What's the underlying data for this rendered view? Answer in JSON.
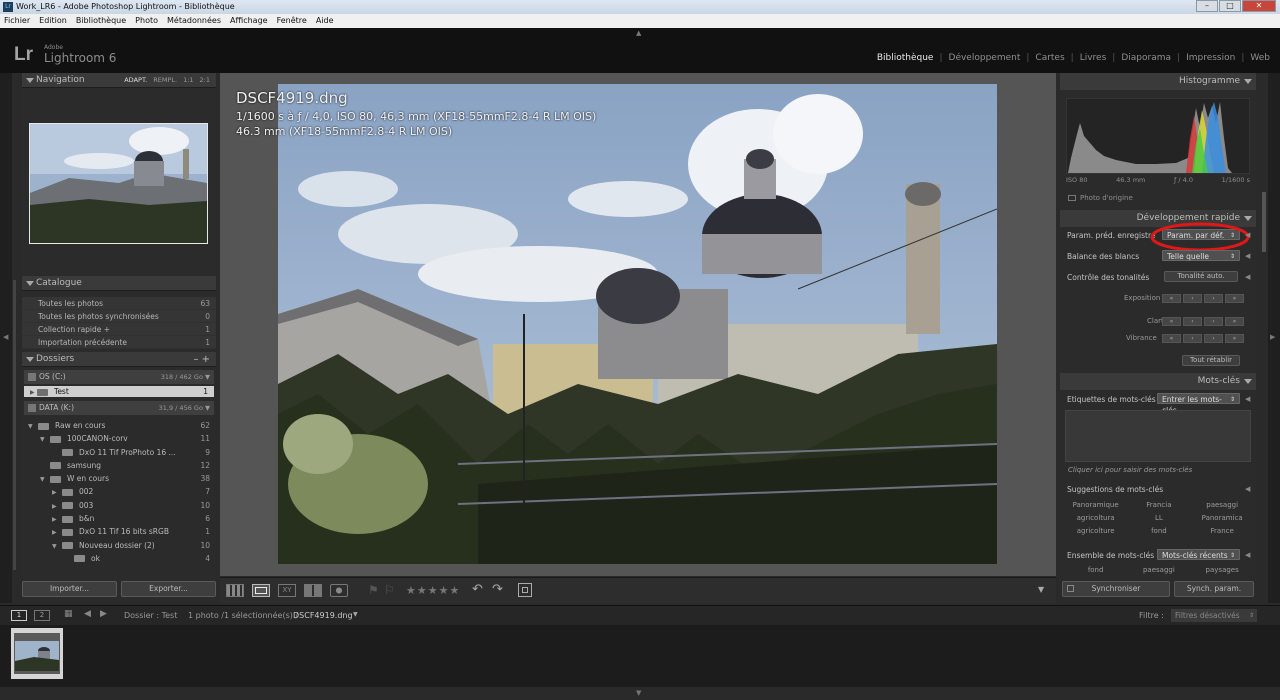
{
  "window": {
    "title": "Work_LR6 - Adobe Photoshop Lightroom - Bibliothèque",
    "app_icon": "Lr",
    "buttons": [
      "–",
      "□",
      "✕"
    ]
  },
  "menu": [
    "Fichier",
    "Edition",
    "Bibliothèque",
    "Photo",
    "Métadonnées",
    "Affichage",
    "Fenêtre",
    "Aide"
  ],
  "brand": {
    "logo": "Lr",
    "adobe": "Adobe",
    "name": "Lightroom 6"
  },
  "modules": [
    {
      "label": "Bibliothèque",
      "active": true
    },
    {
      "label": "Développement"
    },
    {
      "label": "Cartes"
    },
    {
      "label": "Livres"
    },
    {
      "label": "Diaporama"
    },
    {
      "label": "Impression"
    },
    {
      "label": "Web"
    }
  ],
  "left": {
    "navigation": {
      "title": "Navigation",
      "zoom": [
        "ADAPT.",
        "REMPL.",
        "1:1",
        "2:1"
      ]
    },
    "catalog": {
      "title": "Catalogue",
      "items": [
        {
          "label": "Toutes les photos",
          "count": "63"
        },
        {
          "label": "Toutes les photos synchronisées",
          "count": "0"
        },
        {
          "label": "Collection rapide +",
          "count": "1"
        },
        {
          "label": "Importation précédente",
          "count": "1"
        }
      ]
    },
    "folders": {
      "title": "Dossiers",
      "controls": "–  +",
      "volumes": [
        {
          "name": "OS (C:)",
          "size": "318 / 462 Go"
        },
        {
          "name": "DATA (K:)",
          "size": "31,9 / 456 Go"
        }
      ],
      "test_folder": {
        "label": "Test",
        "count": "1"
      },
      "tree": [
        {
          "label": "Raw en cours",
          "count": "62",
          "level": 0,
          "open": true
        },
        {
          "label": "100CANON-corv",
          "count": "11",
          "level": 1,
          "open": true
        },
        {
          "label": "DxO 11 Tif ProPhoto 16 ...",
          "count": "9",
          "level": 2
        },
        {
          "label": "samsung",
          "count": "12",
          "level": 1
        },
        {
          "label": "W en cours",
          "count": "38",
          "level": 1,
          "open": true
        },
        {
          "label": "002",
          "count": "7",
          "level": 2,
          "closed": true
        },
        {
          "label": "003",
          "count": "10",
          "level": 2,
          "closed": true
        },
        {
          "label": "b&n",
          "count": "6",
          "level": 2,
          "closed": true
        },
        {
          "label": "DxO 11 Tif 16 bits sRGB",
          "count": "1",
          "level": 2,
          "closed": true
        },
        {
          "label": "Nouveau dossier (2)",
          "count": "10",
          "level": 2,
          "open": true
        },
        {
          "label": "ok",
          "count": "4",
          "level": 3
        }
      ]
    },
    "import_label": "Importer...",
    "export_label": "Exporter..."
  },
  "photo": {
    "filename": "DSCF4919.dng",
    "info1": "1/1600 s à ƒ / 4,0, ISO 80, 46,3 mm (XF18-55mmF2.8-4 R LM OIS)",
    "info2": "46.3 mm (XF18-55mmF2.8-4 R LM OIS)"
  },
  "toolbar": {
    "stars": "★★★★★"
  },
  "right": {
    "histogram": {
      "title": "Histogramme",
      "iso": "ISO 80",
      "focal": "46.3 mm",
      "aperture": "ƒ / 4.0",
      "shutter": "1/1600 s",
      "original_label": "Photo d'origine"
    },
    "quick_develop": {
      "title": "Développement rapide",
      "preset_label": "Param. préd. enregistré",
      "preset_value": "Param. par déf.",
      "wb_label": "Balance des blancs",
      "wb_value": "Telle quelle",
      "tone_label": "Contrôle des tonalités",
      "tone_auto": "Tonalité auto.",
      "exposure": "Exposition",
      "clarity": "Clarté",
      "vibrance": "Vibrance",
      "reset": "Tout rétablir"
    },
    "keywords": {
      "title": "Mots-clés",
      "tags_label": "Etiquettes de mots-clés",
      "tags_value": "Entrer les mots-clés",
      "click_hint": "Cliquer ici pour saisir des mots-clés",
      "suggestions_label": "Suggestions de mots-clés",
      "suggestions": [
        "Panoramique",
        "Francia",
        "paesaggi",
        "agricoltura",
        "LL",
        "Panoramica",
        "agricolture",
        "fond",
        "France"
      ],
      "set_label": "Ensemble de mots-clés",
      "set_value": "Mots-clés récents",
      "set_items": [
        "fond",
        "paesaggi",
        "paysages"
      ]
    },
    "sync_label": "Synchroniser",
    "sync_params_label": "Synch. param."
  },
  "filmstrip_bar": {
    "pages": [
      "1",
      "2"
    ],
    "folder": "Dossier : Test",
    "selection": "1 photo /1 sélectionnée(s) /",
    "file": "DSCF4919.dng",
    "filter_label": "Filtre :",
    "filter_value": "Filtres désactivés"
  },
  "colors": {
    "header_bg": "#111111",
    "panel_bg": "#2b2b2b",
    "accent_annotation": "#e01818"
  }
}
